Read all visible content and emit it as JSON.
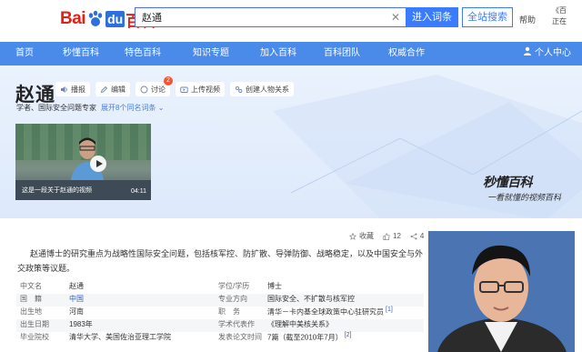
{
  "header": {
    "logo_bai": "Bai",
    "logo_du": "du",
    "logo_baike": "百科",
    "search_value": "赵通",
    "enter_label": "进入词条",
    "all_search_label": "全站搜索",
    "help_label": "帮助",
    "right_line1": "《百",
    "right_line2": "正在"
  },
  "nav": {
    "items": [
      "首页",
      "秒懂百科",
      "特色百科",
      "知识专题",
      "加入百科",
      "百科团队",
      "权威合作"
    ],
    "user_label": "个人中心"
  },
  "hero": {
    "title": "赵通",
    "actions": [
      {
        "label": "播报",
        "icon": "speaker-icon"
      },
      {
        "label": "编辑",
        "icon": "edit-icon"
      },
      {
        "label": "讨论",
        "icon": "comment-icon",
        "badge": "2"
      },
      {
        "label": "上传视频",
        "icon": "video-upload-icon"
      },
      {
        "label": "创建人物关系",
        "icon": "relation-icon"
      }
    ],
    "subtitle": "学者、国际安全问题专家",
    "expand_label": "展开8个同名词条",
    "video_caption": "这是一段关于赵通的视频",
    "video_duration": "04:11",
    "brand": "秒懂百科",
    "slogan": "一看就懂的视频百科"
  },
  "tools": {
    "collect": "收藏",
    "likes": "12",
    "shares": "4"
  },
  "intro": "赵通博士的研究重点为战略性国际安全问题，包括核军控、防扩散、导弹防御、战略稳定，以及中国安全与外交政策等议题。",
  "basic_info": [
    {
      "k1": "中文名",
      "v1": "赵通",
      "k2": "学位/学历",
      "v2": "博士"
    },
    {
      "k1": "国　籍",
      "v1": "中国",
      "v1_link": true,
      "k2": "专业方向",
      "v2": "国际安全、不扩散与核军控"
    },
    {
      "k1": "出生地",
      "v1": "河南",
      "k2": "职　务",
      "v2": "清华－卡内基全球政策中心驻研究员",
      "ref": "[1]"
    },
    {
      "k1": "出生日期",
      "v1": "1983年",
      "k2": "学术代表作",
      "v2": "《理解中美核关系》"
    },
    {
      "k1": "毕业院校",
      "v1": "清华大学、美国佐治亚理工学院",
      "k2": "发表论文时间",
      "v2": "7篇（截至2010年7月）",
      "ref": "[2]"
    }
  ],
  "colors": {
    "nav_blue": "#4a8ae8",
    "accent_blue": "#3b7cff",
    "logo_red": "#de2218",
    "photo_bg": "#4a75b2"
  }
}
